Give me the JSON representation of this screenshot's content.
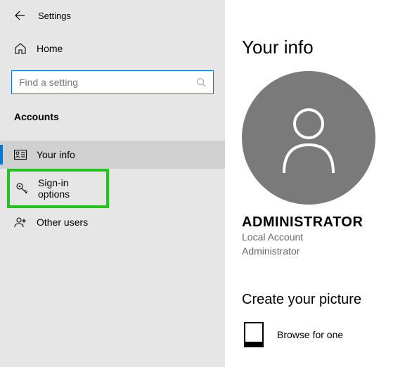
{
  "header": {
    "title": "Settings"
  },
  "sidebar": {
    "home_label": "Home",
    "search_placeholder": "Find a setting",
    "section_label": "Accounts",
    "items": [
      {
        "label": "Your info"
      },
      {
        "label": "Sign-in options"
      },
      {
        "label": "Other users"
      }
    ]
  },
  "content": {
    "page_title": "Your info",
    "account_name": "ADMINISTRATOR",
    "account_type": "Local Account",
    "account_role": "Administrator",
    "picture_section": "Create your picture",
    "browse_label": "Browse for one"
  }
}
